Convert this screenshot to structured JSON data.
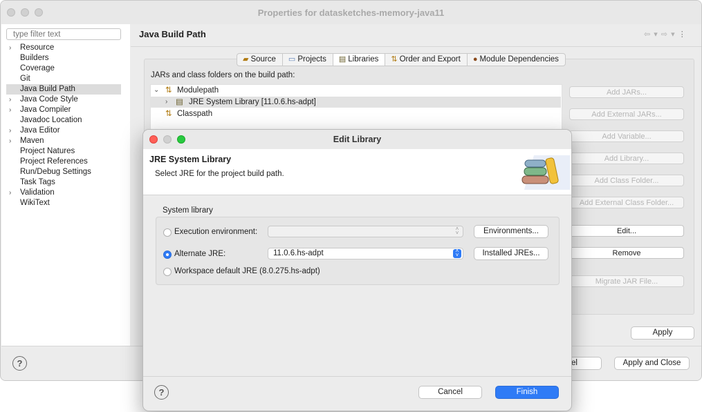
{
  "window": {
    "title": "Properties for datasketches-memory-java11"
  },
  "filter": {
    "placeholder": "type filter text"
  },
  "tree": {
    "items": [
      {
        "label": "Resource",
        "expandable": true
      },
      {
        "label": "Builders",
        "expandable": false
      },
      {
        "label": "Coverage",
        "expandable": false
      },
      {
        "label": "Git",
        "expandable": false
      },
      {
        "label": "Java Build Path",
        "expandable": false,
        "selected": true
      },
      {
        "label": "Java Code Style",
        "expandable": true
      },
      {
        "label": "Java Compiler",
        "expandable": true
      },
      {
        "label": "Javadoc Location",
        "expandable": false
      },
      {
        "label": "Java Editor",
        "expandable": true
      },
      {
        "label": "Maven",
        "expandable": true
      },
      {
        "label": "Project Natures",
        "expandable": false
      },
      {
        "label": "Project References",
        "expandable": false
      },
      {
        "label": "Run/Debug Settings",
        "expandable": false
      },
      {
        "label": "Task Tags",
        "expandable": false
      },
      {
        "label": "Validation",
        "expandable": true
      },
      {
        "label": "WikiText",
        "expandable": false
      }
    ]
  },
  "page": {
    "title": "Java Build Path",
    "tabs": [
      "Source",
      "Projects",
      "Libraries",
      "Order and Export",
      "Module Dependencies"
    ],
    "active_tab": "Libraries",
    "classpath_label": "JARs and class folders on the build path:",
    "entries": [
      "Modulepath",
      "JRE System Library [11.0.6.hs-adpt]",
      "Classpath"
    ],
    "buttons": {
      "add_jars": "Add JARs...",
      "add_external_jars": "Add External JARs...",
      "add_variable": "Add Variable...",
      "add_library": "Add Library...",
      "add_class_folder": "Add Class Folder...",
      "add_external_class_folder": "Add External Class Folder...",
      "edit": "Edit...",
      "remove": "Remove",
      "migrate_jar": "Migrate JAR File..."
    },
    "apply": "Apply",
    "cancel_partial": "el",
    "apply_and_close": "Apply and Close"
  },
  "dialog": {
    "title": "Edit Library",
    "header_title": "JRE System Library",
    "header_desc": "Select JRE for the project build path.",
    "group_label": "System library",
    "options": {
      "exec_env": "Execution environment:",
      "alternate": "Alternate JRE:",
      "workspace": "Workspace default JRE (8.0.275.hs-adpt)"
    },
    "alternate_value": "11.0.6.hs-adpt",
    "environments_button": "Environments...",
    "installed_button": "Installed JREs...",
    "cancel": "Cancel",
    "finish": "Finish"
  },
  "help_glyph": "?",
  "colors": {
    "accent": "#2f7bf6",
    "close": "#ff5f57",
    "minimize": "#d0d0d0",
    "zoom": "#28c940"
  }
}
